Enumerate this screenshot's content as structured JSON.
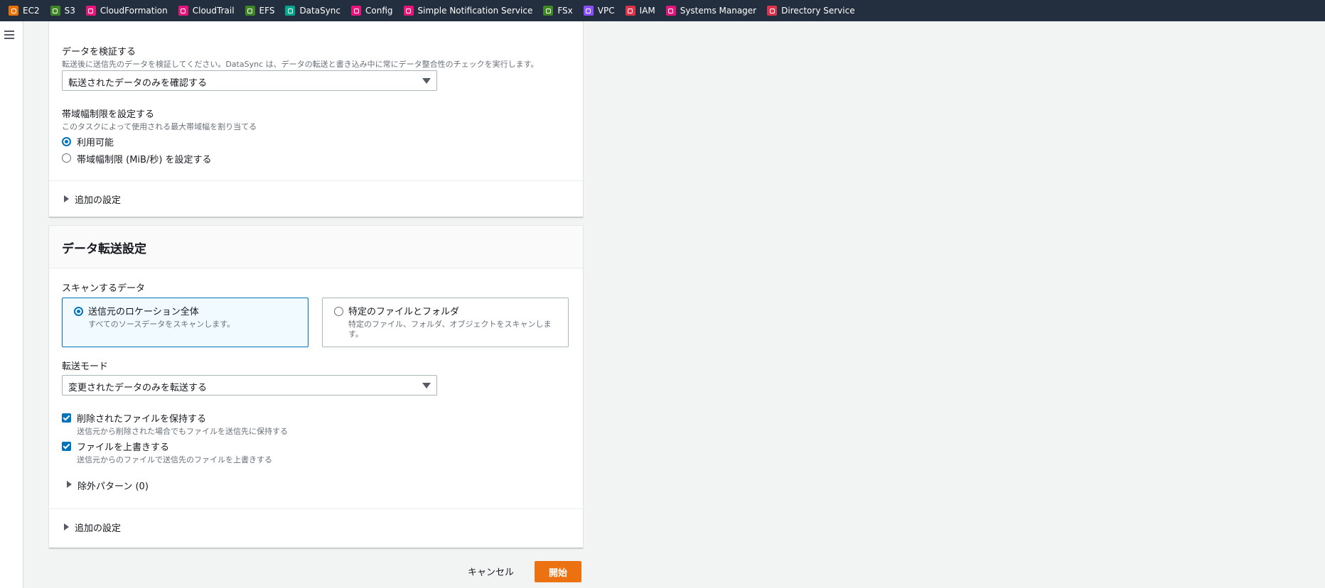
{
  "topbar": {
    "services": [
      {
        "label": "EC2",
        "color": "#ed7100",
        "icon": "ec2-icon"
      },
      {
        "label": "S3",
        "color": "#3f8624",
        "icon": "s3-icon"
      },
      {
        "label": "CloudFormation",
        "color": "#e7157b",
        "icon": "cloudformation-icon"
      },
      {
        "label": "CloudTrail",
        "color": "#e7157b",
        "icon": "cloudtrail-icon"
      },
      {
        "label": "EFS",
        "color": "#3f8624",
        "icon": "efs-icon"
      },
      {
        "label": "DataSync",
        "color": "#01a88d",
        "icon": "datasync-icon"
      },
      {
        "label": "Config",
        "color": "#e7157b",
        "icon": "config-icon"
      },
      {
        "label": "Simple Notification Service",
        "color": "#e7157b",
        "icon": "sns-icon"
      },
      {
        "label": "FSx",
        "color": "#3f8624",
        "icon": "fsx-icon"
      },
      {
        "label": "VPC",
        "color": "#8c4fff",
        "icon": "vpc-icon"
      },
      {
        "label": "IAM",
        "color": "#dd344c",
        "icon": "iam-icon"
      },
      {
        "label": "Systems Manager",
        "color": "#e7157b",
        "icon": "systems-manager-icon"
      },
      {
        "label": "Directory Service",
        "color": "#dd344c",
        "icon": "directory-service-icon"
      }
    ]
  },
  "panel1": {
    "verify": {
      "label": "データを検証する",
      "description": "転送後に送信先のデータを検証してください。DataSync は、データの転送と書き込み中に常にデータ整合性のチェックを実行します。",
      "selected": "転送されたデータのみを確認する"
    },
    "bandwidth": {
      "label": "帯域幅制限を設定する",
      "description": "このタスクによって使用される最大帯域幅を割り当てる",
      "options": [
        {
          "label": "利用可能",
          "selected": true
        },
        {
          "label": "帯域幅制限 (MiB/秒) を設定する",
          "selected": false
        }
      ]
    },
    "additional": "追加の設定"
  },
  "panel2": {
    "title": "データ転送設定",
    "scan": {
      "label": "スキャンするデータ",
      "tiles": [
        {
          "title": "送信元のロケーション全体",
          "description": "すべてのソースデータをスキャンします。",
          "selected": true
        },
        {
          "title": "特定のファイルとフォルダ",
          "description": "特定のファイル、フォルダ、オブジェクトをスキャンしま",
          "description2": "す。",
          "selected": false
        }
      ]
    },
    "mode": {
      "label": "転送モード",
      "selected": "変更されたデータのみを転送する"
    },
    "checks": [
      {
        "label": "削除されたファイルを保持する",
        "description": "送信元から削除された場合でもファイルを送信先に保持する",
        "checked": true
      },
      {
        "label": "ファイルを上書きする",
        "description": "送信元からのファイルで送信先のファイルを上書きする",
        "checked": true
      }
    ],
    "exclude": "除外パターン (0)",
    "additional": "追加の設定"
  },
  "footer": {
    "cancel": "キャンセル",
    "start": "開始"
  },
  "colors": {
    "topbar": "#232f3e",
    "primary": "#ec7211",
    "accent": "#0073bb"
  }
}
